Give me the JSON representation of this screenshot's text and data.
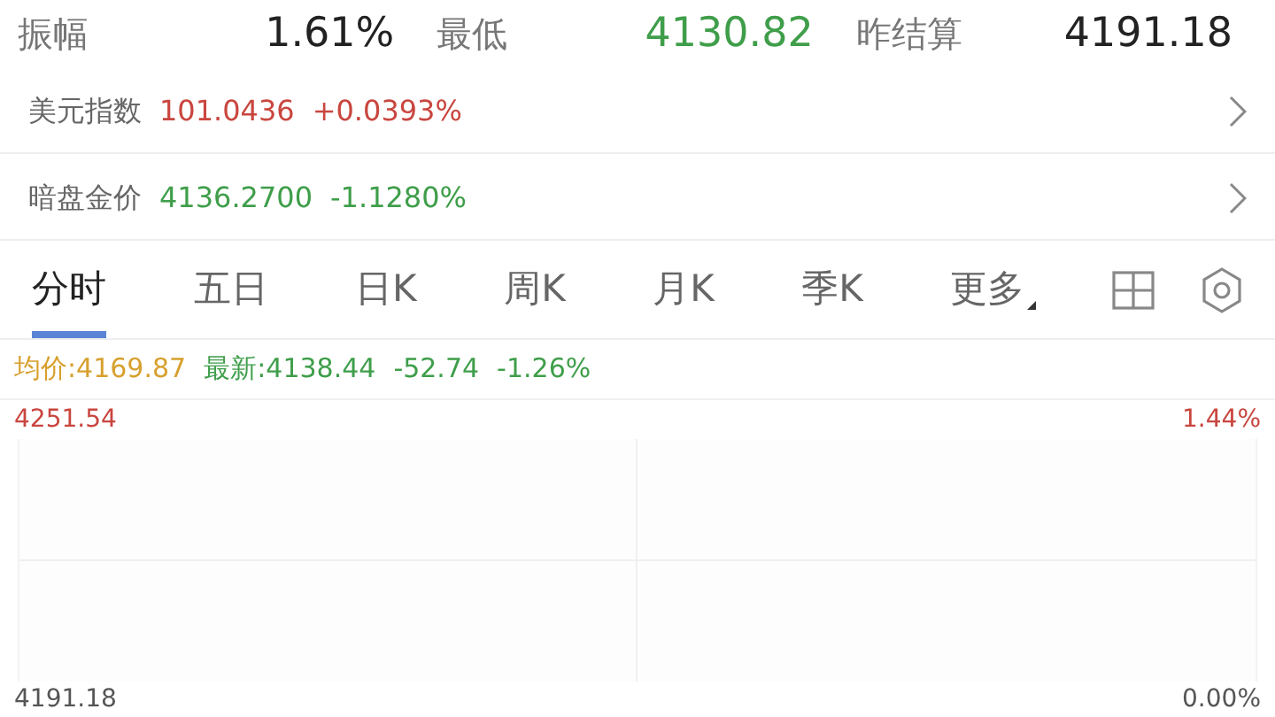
{
  "stats": [
    {
      "label": "振幅",
      "value": "1.61%",
      "color": "#222222"
    },
    {
      "label": "最低",
      "value": "4130.82",
      "color": "#3f9e4a"
    },
    {
      "label": "昨结算",
      "value": "4191.18",
      "color": "#222222"
    }
  ],
  "quotes": [
    {
      "name": "美元指数",
      "price": "101.0436",
      "change": "+0.0393%",
      "color": "#c9463f"
    },
    {
      "name": "暗盘金价",
      "price": "4136.2700",
      "change": "-1.1280%",
      "color": "#3f9e4a"
    }
  ],
  "tabs": [
    {
      "label": "分时",
      "selected": true,
      "kind": "tab"
    },
    {
      "label": "五日",
      "selected": false,
      "kind": "tab"
    },
    {
      "label": "日K",
      "selected": false,
      "kind": "tab"
    },
    {
      "label": "周K",
      "selected": false,
      "kind": "tab"
    },
    {
      "label": "月K",
      "selected": false,
      "kind": "tab"
    },
    {
      "label": "季K",
      "selected": false,
      "kind": "tab"
    },
    {
      "label": "更多",
      "selected": false,
      "kind": "more"
    }
  ],
  "info": {
    "avg": "均价:4169.87",
    "latest": "最新:4138.44",
    "change": "-52.74",
    "change_pct": "-1.26%"
  },
  "chart": {
    "top_price": "4251.54",
    "top_pct": "1.44%",
    "base_price": "4191.18",
    "base_pct": "0.00%"
  }
}
